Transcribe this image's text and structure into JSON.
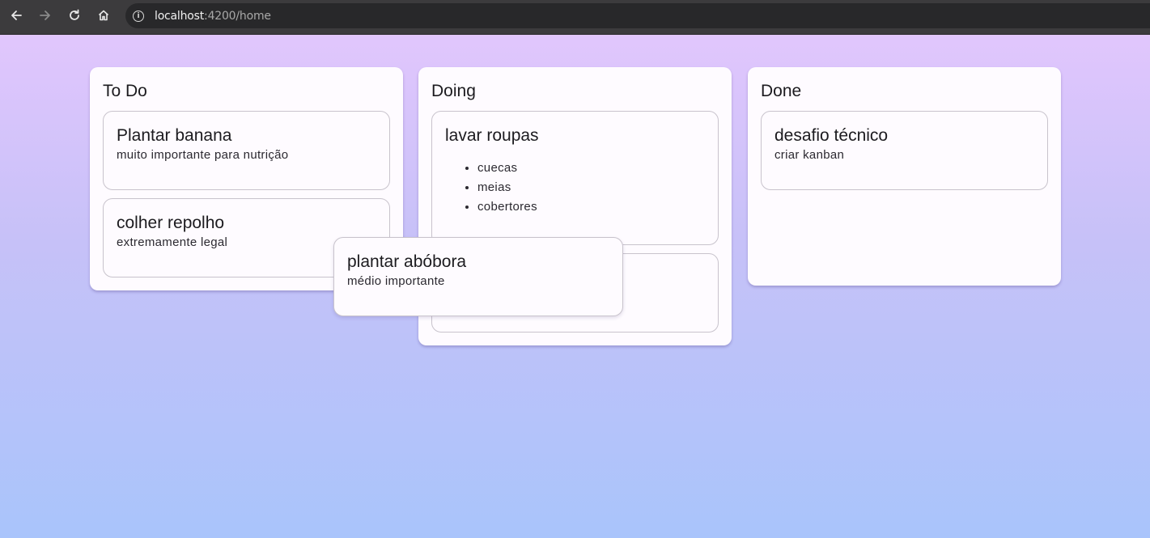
{
  "browser": {
    "back_icon": "arrow-left-icon",
    "forward_icon": "arrow-right-icon",
    "reload_icon": "reload-icon",
    "home_icon": "home-icon",
    "info_icon": "info-icon",
    "url_host": "localhost",
    "url_path": ":4200/home"
  },
  "board": {
    "columns": [
      {
        "title": "To Do",
        "cards": [
          {
            "title": "Plantar banana",
            "description": "muito importante para nutrição"
          },
          {
            "title": "colher repolho",
            "description": "extremamente legal"
          }
        ]
      },
      {
        "title": "Doing",
        "cards": [
          {
            "title": "lavar roupas",
            "items": [
              "cuecas",
              "meias",
              "cobertores"
            ]
          },
          {
            "title": "",
            "description": ""
          }
        ]
      },
      {
        "title": "Done",
        "cards": [
          {
            "title": "desafio técnico",
            "description": "criar kanban"
          }
        ]
      }
    ],
    "dragging_card": {
      "title": "plantar abóbora",
      "description": "médio importante"
    }
  },
  "colors": {
    "gradient_top": "#e1c6fd",
    "gradient_bottom": "#a9c4fb",
    "card_background": "#fefbff",
    "card_border": "#c8c3cc",
    "browser_chrome": "#3c3b3d"
  }
}
